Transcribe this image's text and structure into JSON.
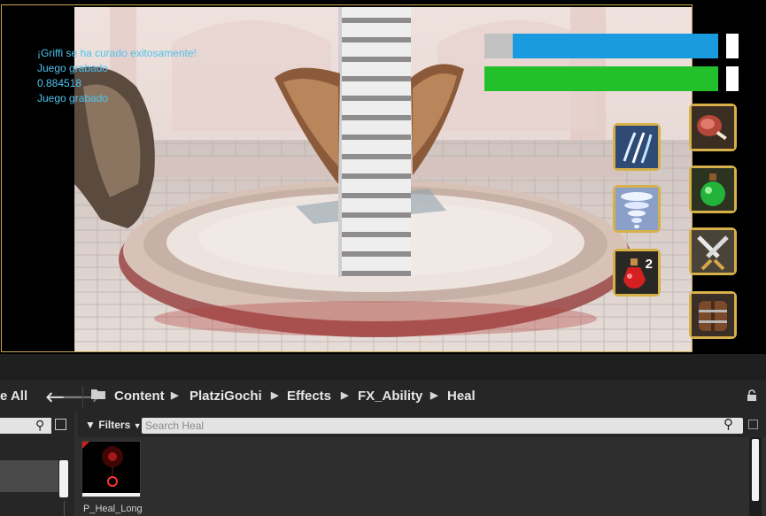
{
  "game_log": {
    "lines": [
      "¡Griffi se ha curado exitosamente!",
      "Juego grabado",
      "0.884518",
      "Juego grabado"
    ]
  },
  "hud": {
    "health_fill": 0.88,
    "stamina_fill": 1.0,
    "ability_count": "2",
    "bar_colors": {
      "health": "#1a9be0",
      "stamina": "#22c12b",
      "empty": "#c2c2c2"
    }
  },
  "abilities": {
    "left": [
      "claw-slash-icon",
      "tornado-icon",
      "red-potion-icon"
    ],
    "right": [
      "meat-icon",
      "green-potion-icon",
      "crossed-swords-icon",
      "wooden-shield-icon"
    ]
  },
  "content_browser": {
    "save_all_label": "e All",
    "breadcrumbs": [
      "Content",
      "PlatziGochi",
      "Effects",
      "FX_Ability",
      "Heal"
    ],
    "filters_label": "Filters",
    "search_placeholder": "Search Heal",
    "asset_name": "P_Heal_Long"
  }
}
